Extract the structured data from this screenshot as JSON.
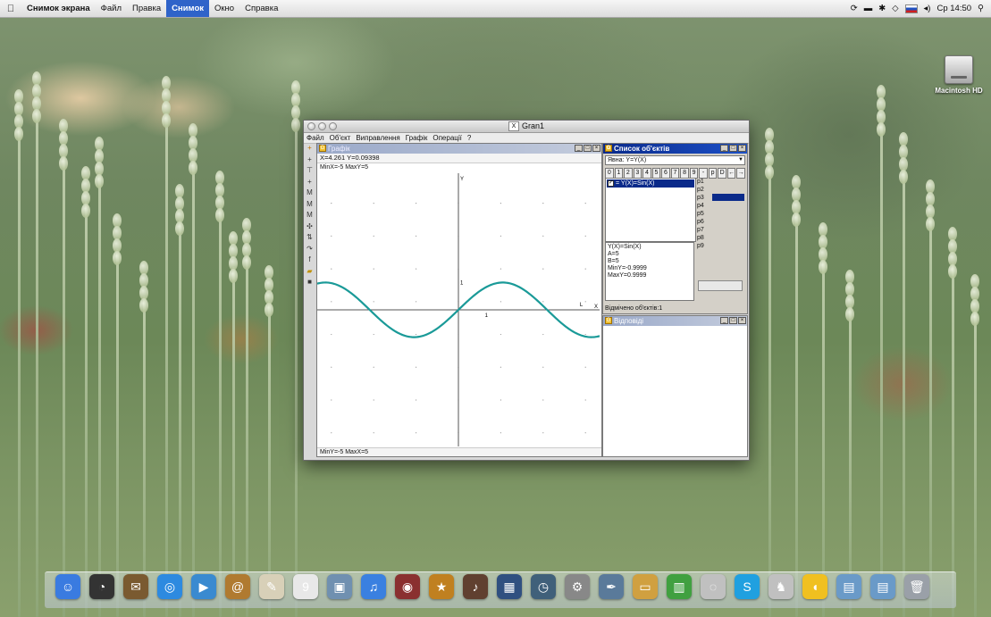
{
  "menubar": {
    "app_name": "Снимок экрана",
    "items": [
      "Файл",
      "Правка",
      "Снимок",
      "Окно",
      "Справка"
    ],
    "selected_item": "Снимок",
    "clock": "Ср 14:50"
  },
  "desktop": {
    "drive_label": "Macintosh HD"
  },
  "app_window": {
    "title": "Gran1",
    "menu": [
      "Файл",
      "Об'єкт",
      "Виправлення",
      "Графік",
      "Операції",
      "?"
    ]
  },
  "graph_window": {
    "title": "Графік",
    "coords": "X=4.261  Y=0.09398",
    "range_top": "MinX=-5  MaxY=5",
    "range_bottom": "MinY=-5  MaxX=5",
    "axis_x": "X",
    "axis_y": "Y",
    "tick_x": "1",
    "tick_y": "1",
    "curve_label": "L",
    "function": "Y(X)=Sin(X)",
    "curve_color": "#1a9a98",
    "x_range": [
      -5,
      5
    ],
    "y_range": [
      -5,
      5
    ]
  },
  "objects_window": {
    "title": "Список об'єктів",
    "type_label": "Явна: Y=Y(X)",
    "digits": [
      "0",
      "1",
      "2",
      "3",
      "4",
      "5",
      "6",
      "7",
      "8",
      "9",
      "-",
      "p",
      "D",
      "←",
      "→"
    ],
    "list_item": "= Y(X)=Sin(X)",
    "params": [
      "p1",
      "p2",
      "p3",
      "p4",
      "p5",
      "p6",
      "p7",
      "p8",
      "p9"
    ],
    "selected_param": "p3",
    "props": [
      "Y(X)=Sin(X)",
      "A=5",
      "B=5",
      "MinY=-0.9999",
      "MaxY=0.9999"
    ],
    "count": "Відмічено об'єктів:1"
  },
  "response_window": {
    "title": "Відповіді"
  },
  "dock": {
    "icons": [
      "finder-icon",
      "dashboard-icon",
      "mail-stamp-icon",
      "safari-icon",
      "facetime-icon",
      "address-book-icon",
      "textedit-icon",
      "ical-icon",
      "preview-icon",
      "itunes-icon",
      "photo-booth-icon",
      "imovie-icon",
      "garageband-icon",
      "spaces-icon",
      "time-machine-icon",
      "system-preferences-icon",
      "script-editor-icon",
      "keynote-icon",
      "numbers-icon",
      "disk-utility-icon",
      "skype-icon",
      "chess-icon",
      "adium-icon",
      "documents-folder-icon",
      "downloads-folder-icon",
      "trash-icon"
    ]
  }
}
